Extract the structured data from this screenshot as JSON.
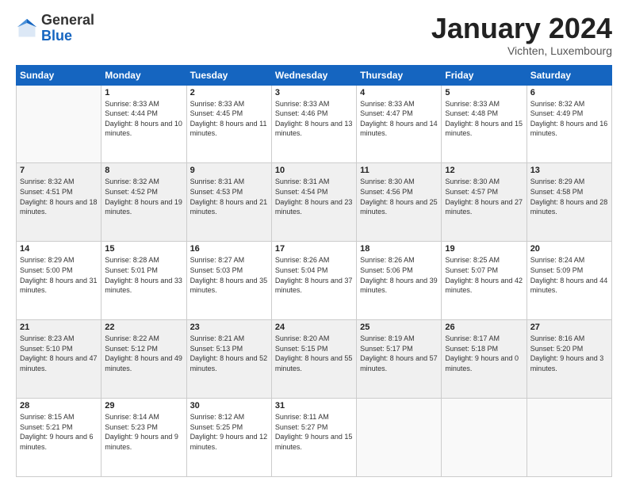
{
  "header": {
    "logo_general": "General",
    "logo_blue": "Blue",
    "month_title": "January 2024",
    "subtitle": "Vichten, Luxembourg"
  },
  "days_of_week": [
    "Sunday",
    "Monday",
    "Tuesday",
    "Wednesday",
    "Thursday",
    "Friday",
    "Saturday"
  ],
  "weeks": [
    [
      {
        "day": "",
        "sunrise": "",
        "sunset": "",
        "daylight": ""
      },
      {
        "day": "1",
        "sunrise": "Sunrise: 8:33 AM",
        "sunset": "Sunset: 4:44 PM",
        "daylight": "Daylight: 8 hours and 10 minutes."
      },
      {
        "day": "2",
        "sunrise": "Sunrise: 8:33 AM",
        "sunset": "Sunset: 4:45 PM",
        "daylight": "Daylight: 8 hours and 11 minutes."
      },
      {
        "day": "3",
        "sunrise": "Sunrise: 8:33 AM",
        "sunset": "Sunset: 4:46 PM",
        "daylight": "Daylight: 8 hours and 13 minutes."
      },
      {
        "day": "4",
        "sunrise": "Sunrise: 8:33 AM",
        "sunset": "Sunset: 4:47 PM",
        "daylight": "Daylight: 8 hours and 14 minutes."
      },
      {
        "day": "5",
        "sunrise": "Sunrise: 8:33 AM",
        "sunset": "Sunset: 4:48 PM",
        "daylight": "Daylight: 8 hours and 15 minutes."
      },
      {
        "day": "6",
        "sunrise": "Sunrise: 8:32 AM",
        "sunset": "Sunset: 4:49 PM",
        "daylight": "Daylight: 8 hours and 16 minutes."
      }
    ],
    [
      {
        "day": "7",
        "sunrise": "Sunrise: 8:32 AM",
        "sunset": "Sunset: 4:51 PM",
        "daylight": "Daylight: 8 hours and 18 minutes."
      },
      {
        "day": "8",
        "sunrise": "Sunrise: 8:32 AM",
        "sunset": "Sunset: 4:52 PM",
        "daylight": "Daylight: 8 hours and 19 minutes."
      },
      {
        "day": "9",
        "sunrise": "Sunrise: 8:31 AM",
        "sunset": "Sunset: 4:53 PM",
        "daylight": "Daylight: 8 hours and 21 minutes."
      },
      {
        "day": "10",
        "sunrise": "Sunrise: 8:31 AM",
        "sunset": "Sunset: 4:54 PM",
        "daylight": "Daylight: 8 hours and 23 minutes."
      },
      {
        "day": "11",
        "sunrise": "Sunrise: 8:30 AM",
        "sunset": "Sunset: 4:56 PM",
        "daylight": "Daylight: 8 hours and 25 minutes."
      },
      {
        "day": "12",
        "sunrise": "Sunrise: 8:30 AM",
        "sunset": "Sunset: 4:57 PM",
        "daylight": "Daylight: 8 hours and 27 minutes."
      },
      {
        "day": "13",
        "sunrise": "Sunrise: 8:29 AM",
        "sunset": "Sunset: 4:58 PM",
        "daylight": "Daylight: 8 hours and 28 minutes."
      }
    ],
    [
      {
        "day": "14",
        "sunrise": "Sunrise: 8:29 AM",
        "sunset": "Sunset: 5:00 PM",
        "daylight": "Daylight: 8 hours and 31 minutes."
      },
      {
        "day": "15",
        "sunrise": "Sunrise: 8:28 AM",
        "sunset": "Sunset: 5:01 PM",
        "daylight": "Daylight: 8 hours and 33 minutes."
      },
      {
        "day": "16",
        "sunrise": "Sunrise: 8:27 AM",
        "sunset": "Sunset: 5:03 PM",
        "daylight": "Daylight: 8 hours and 35 minutes."
      },
      {
        "day": "17",
        "sunrise": "Sunrise: 8:26 AM",
        "sunset": "Sunset: 5:04 PM",
        "daylight": "Daylight: 8 hours and 37 minutes."
      },
      {
        "day": "18",
        "sunrise": "Sunrise: 8:26 AM",
        "sunset": "Sunset: 5:06 PM",
        "daylight": "Daylight: 8 hours and 39 minutes."
      },
      {
        "day": "19",
        "sunrise": "Sunrise: 8:25 AM",
        "sunset": "Sunset: 5:07 PM",
        "daylight": "Daylight: 8 hours and 42 minutes."
      },
      {
        "day": "20",
        "sunrise": "Sunrise: 8:24 AM",
        "sunset": "Sunset: 5:09 PM",
        "daylight": "Daylight: 8 hours and 44 minutes."
      }
    ],
    [
      {
        "day": "21",
        "sunrise": "Sunrise: 8:23 AM",
        "sunset": "Sunset: 5:10 PM",
        "daylight": "Daylight: 8 hours and 47 minutes."
      },
      {
        "day": "22",
        "sunrise": "Sunrise: 8:22 AM",
        "sunset": "Sunset: 5:12 PM",
        "daylight": "Daylight: 8 hours and 49 minutes."
      },
      {
        "day": "23",
        "sunrise": "Sunrise: 8:21 AM",
        "sunset": "Sunset: 5:13 PM",
        "daylight": "Daylight: 8 hours and 52 minutes."
      },
      {
        "day": "24",
        "sunrise": "Sunrise: 8:20 AM",
        "sunset": "Sunset: 5:15 PM",
        "daylight": "Daylight: 8 hours and 55 minutes."
      },
      {
        "day": "25",
        "sunrise": "Sunrise: 8:19 AM",
        "sunset": "Sunset: 5:17 PM",
        "daylight": "Daylight: 8 hours and 57 minutes."
      },
      {
        "day": "26",
        "sunrise": "Sunrise: 8:17 AM",
        "sunset": "Sunset: 5:18 PM",
        "daylight": "Daylight: 9 hours and 0 minutes."
      },
      {
        "day": "27",
        "sunrise": "Sunrise: 8:16 AM",
        "sunset": "Sunset: 5:20 PM",
        "daylight": "Daylight: 9 hours and 3 minutes."
      }
    ],
    [
      {
        "day": "28",
        "sunrise": "Sunrise: 8:15 AM",
        "sunset": "Sunset: 5:21 PM",
        "daylight": "Daylight: 9 hours and 6 minutes."
      },
      {
        "day": "29",
        "sunrise": "Sunrise: 8:14 AM",
        "sunset": "Sunset: 5:23 PM",
        "daylight": "Daylight: 9 hours and 9 minutes."
      },
      {
        "day": "30",
        "sunrise": "Sunrise: 8:12 AM",
        "sunset": "Sunset: 5:25 PM",
        "daylight": "Daylight: 9 hours and 12 minutes."
      },
      {
        "day": "31",
        "sunrise": "Sunrise: 8:11 AM",
        "sunset": "Sunset: 5:27 PM",
        "daylight": "Daylight: 9 hours and 15 minutes."
      },
      {
        "day": "",
        "sunrise": "",
        "sunset": "",
        "daylight": ""
      },
      {
        "day": "",
        "sunrise": "",
        "sunset": "",
        "daylight": ""
      },
      {
        "day": "",
        "sunrise": "",
        "sunset": "",
        "daylight": ""
      }
    ]
  ]
}
